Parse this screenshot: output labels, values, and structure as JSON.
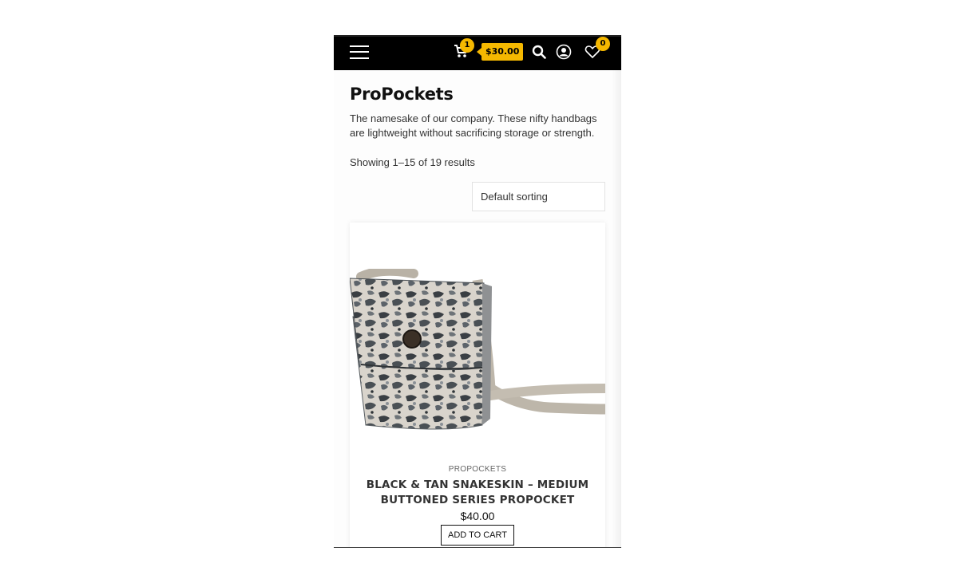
{
  "header": {
    "cart_count": "1",
    "cart_total": "$30.00",
    "wishlist_count": "0"
  },
  "page": {
    "title": "ProPockets",
    "description": "The namesake of our company. These nifty handbags are lightweight without sacrificing storage or strength.",
    "results": "Showing 1–15 of 19 results",
    "sorting": "Default sorting"
  },
  "product": {
    "category": "PROPOCKETS",
    "name": "BLACK & TAN SNAKESKIN – MEDIUM BUTTONED SERIES PROPOCKET",
    "price": "$40.00",
    "add_to_cart": "ADD TO CART"
  },
  "colors": {
    "accent": "#f5b800",
    "topbar": "#000000"
  }
}
